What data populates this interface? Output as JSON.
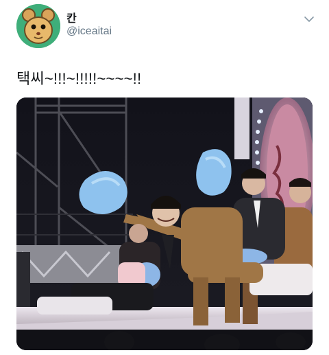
{
  "tweet": {
    "display_name": "칸",
    "handle": "@iceaitai",
    "text": "택씨~!!!~!!!!!~~~~!!",
    "avatar_icon": "cartoon-mouse-avatar-icon",
    "menu_icon": "chevron-down-icon",
    "photo_icon": "concert-photo-image"
  },
  "colors": {
    "handle": "#657786",
    "text": "#14171a",
    "avatar_bg": "#3fae7a"
  }
}
